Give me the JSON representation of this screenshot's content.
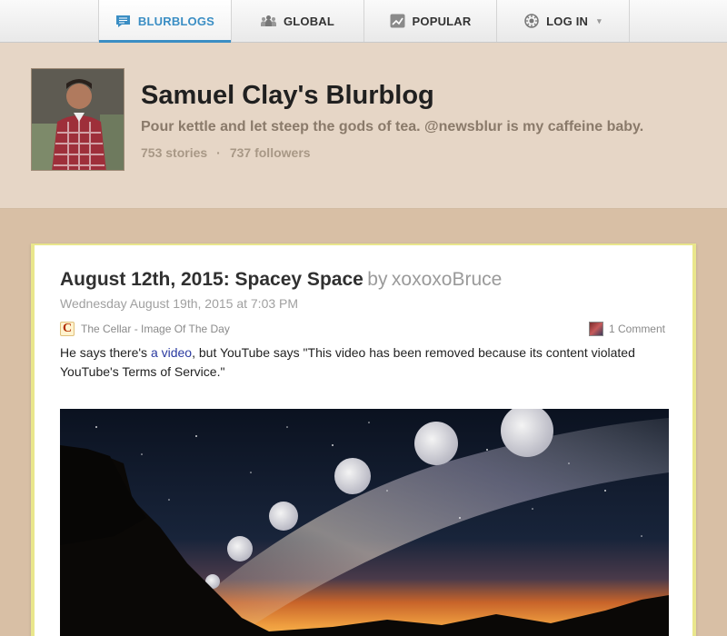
{
  "nav": {
    "blurblogs": {
      "label": "BLURBLOGS",
      "icon": "speech-bubble-icon"
    },
    "global": {
      "label": "GLOBAL",
      "icon": "people-icon"
    },
    "popular": {
      "label": "POPULAR",
      "icon": "trend-chart-icon"
    },
    "login": {
      "label": "LOG IN",
      "icon": "gear-icon",
      "caret": "▾"
    }
  },
  "header": {
    "title": "Samuel Clay's Blurblog",
    "description": "Pour kettle and let steep the gods of tea. @newsblur is my caffeine baby.",
    "stories": "753 stories",
    "separator": "·",
    "followers": "737 followers"
  },
  "story": {
    "title": "August 12th, 2015: Spacey Space",
    "by": "by",
    "author": "xoxoxoBruce",
    "date": "Wednesday August 19th, 2015 at 7:03 PM",
    "feed_icon_letter": "C",
    "feed_name": "The Cellar - Image Of The Day",
    "comments": "1 Comment",
    "body_before": "He says there's ",
    "body_link": "a video",
    "body_after": ", but YouTube says \"This video has been removed because its content violated YouTube's Terms of Service.\""
  },
  "colors": {
    "accent": "#3b8ec4",
    "background": "#d8bfa5",
    "card_border": "#e9e68c"
  }
}
